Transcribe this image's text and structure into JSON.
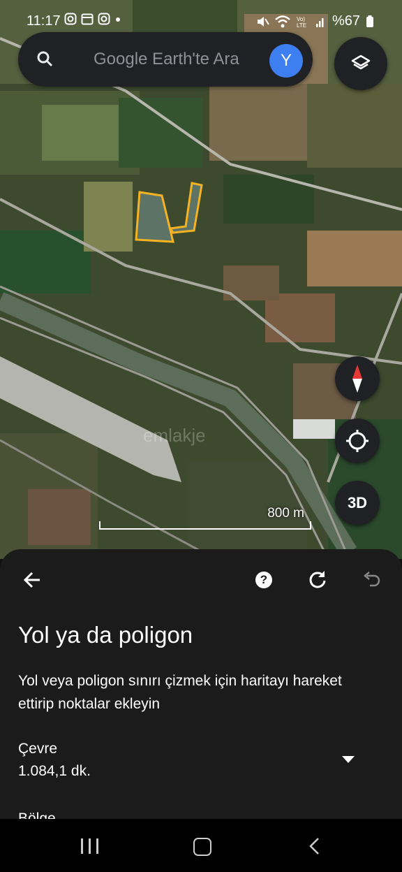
{
  "status_bar": {
    "time": "11:17",
    "notification_icons": [
      "instagram-icon",
      "calendar-icon",
      "instagram-icon",
      "dot-icon"
    ],
    "battery_text": "%67",
    "status_icons": [
      "mute-icon",
      "wifi-icon",
      "volte-icon",
      "signal-icon",
      "battery-icon"
    ]
  },
  "search": {
    "placeholder": "Google Earth'te Ara",
    "avatar_letter": "Y"
  },
  "map": {
    "scale_label": "800 m",
    "watermark": "emlakje",
    "polygon_color": "#f5b323",
    "controls": {
      "button_3d": "3D"
    }
  },
  "sheet": {
    "title": "Yol ya da poligon",
    "description": "Yol veya poligon sınırı çizmek için haritayı hareket ettirip noktalar ekleyin",
    "perimeter_label": "Çevre",
    "perimeter_value": "1.084,1 dk.",
    "area_label": "Bölge"
  },
  "colors": {
    "sheet_bg": "#1b1b1b",
    "avatar_bg": "#3d7ff0"
  }
}
